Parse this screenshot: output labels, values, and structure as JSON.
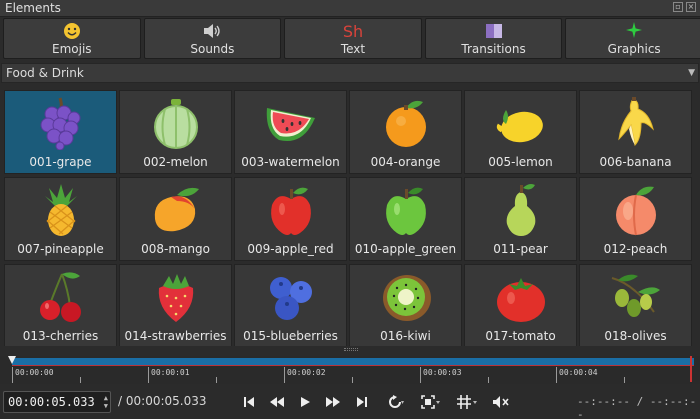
{
  "panel": {
    "title": "Elements"
  },
  "tabs": [
    {
      "label": "Emojis",
      "icon": "smiley-icon"
    },
    {
      "label": "Sounds",
      "icon": "speaker-icon"
    },
    {
      "label": "Text",
      "icon_text": "Sh",
      "icon": "text-icon"
    },
    {
      "label": "Transitions",
      "icon": "transition-icon"
    },
    {
      "label": "Graphics",
      "icon": "sparkle-icon"
    }
  ],
  "category": {
    "selected": "Food & Drink"
  },
  "items": [
    {
      "label": "001-grape",
      "icon": "grape-icon",
      "selected": true
    },
    {
      "label": "002-melon",
      "icon": "melon-icon"
    },
    {
      "label": "003-watermelon",
      "icon": "watermelon-icon"
    },
    {
      "label": "004-orange",
      "icon": "orange-icon"
    },
    {
      "label": "005-lemon",
      "icon": "lemon-icon"
    },
    {
      "label": "006-banana",
      "icon": "banana-icon"
    },
    {
      "label": "007-pineapple",
      "icon": "pineapple-icon"
    },
    {
      "label": "008-mango",
      "icon": "mango-icon"
    },
    {
      "label": "009-apple_red",
      "icon": "red-apple-icon"
    },
    {
      "label": "010-apple_green",
      "icon": "green-apple-icon"
    },
    {
      "label": "011-pear",
      "icon": "pear-icon"
    },
    {
      "label": "012-peach",
      "icon": "peach-icon"
    },
    {
      "label": "013-cherries",
      "icon": "cherries-icon"
    },
    {
      "label": "014-strawberries",
      "icon": "strawberry-icon"
    },
    {
      "label": "015-blueberries",
      "icon": "blueberries-icon"
    },
    {
      "label": "016-kiwi",
      "icon": "kiwi-icon"
    },
    {
      "label": "017-tomato",
      "icon": "tomato-icon"
    },
    {
      "label": "018-olives",
      "icon": "olives-icon"
    }
  ],
  "ruler": {
    "labels": [
      "00:00:00",
      "00:00:01",
      "00:00:02",
      "00:00:03",
      "00:00:04"
    ]
  },
  "transport": {
    "timecode": "00:00:05.033",
    "separator": "/",
    "total": "00:00:05.033",
    "right_timecode": "--:--:-- / --:--:--"
  },
  "colors": {
    "selection": "#1b5b7a",
    "zone": "#1a6ea6",
    "text_tab_icon": "#d9433b",
    "graphics_icon": "#2ecc40"
  }
}
